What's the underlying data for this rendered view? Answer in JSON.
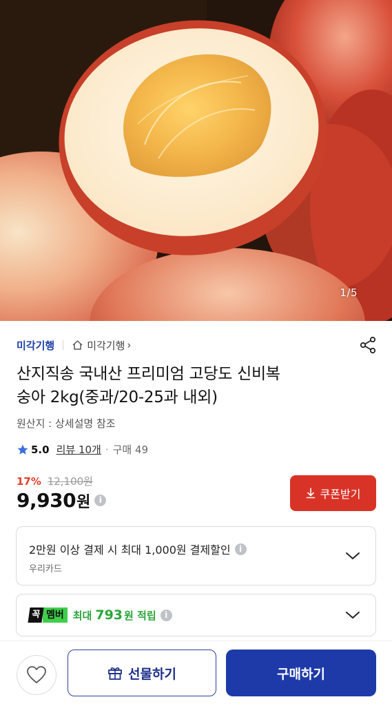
{
  "gallery": {
    "counter": "1/5"
  },
  "product": {
    "seller": "미각기행",
    "store_link": "미각기행",
    "store_arrow": "›",
    "title_line1": "산지직송 국내산 프리미엄 고당도 신비복",
    "title_line2": "숭아 2kg(중과/20-25과 내외)",
    "origin": "원산지 : 상세설명 참조",
    "rating": "5.0",
    "reviews": "리뷰 10개",
    "dot": "·",
    "purchases": "구매 49",
    "discount_rate": "17%",
    "original_price": "12,100원",
    "price": "9,930",
    "currency": "원"
  },
  "coupon": {
    "label": "쿠폰받기"
  },
  "payment_benefit": {
    "text": "2만원 이상 결제 시 최대 1,000원 결제할인",
    "card": "우리카드"
  },
  "membership": {
    "badge_left": "꼭",
    "badge_right": "멤버",
    "prefix": "최대",
    "amount": "793",
    "suffix": "원 적립"
  },
  "bottom": {
    "gift_label": "선물하기",
    "buy_label": "구매하기"
  },
  "info_glyph": "i",
  "colors": {
    "brand_blue": "#1d3aa8",
    "coupon_red": "#d93328",
    "discount_red": "#e23d2b",
    "member_green": "#2aa63a",
    "star_blue": "#3a6fe0"
  },
  "icons": [
    "home-icon",
    "share-icon",
    "star-icon",
    "info-icon",
    "download-icon",
    "chevron-down-icon",
    "heart-icon",
    "gift-icon"
  ]
}
